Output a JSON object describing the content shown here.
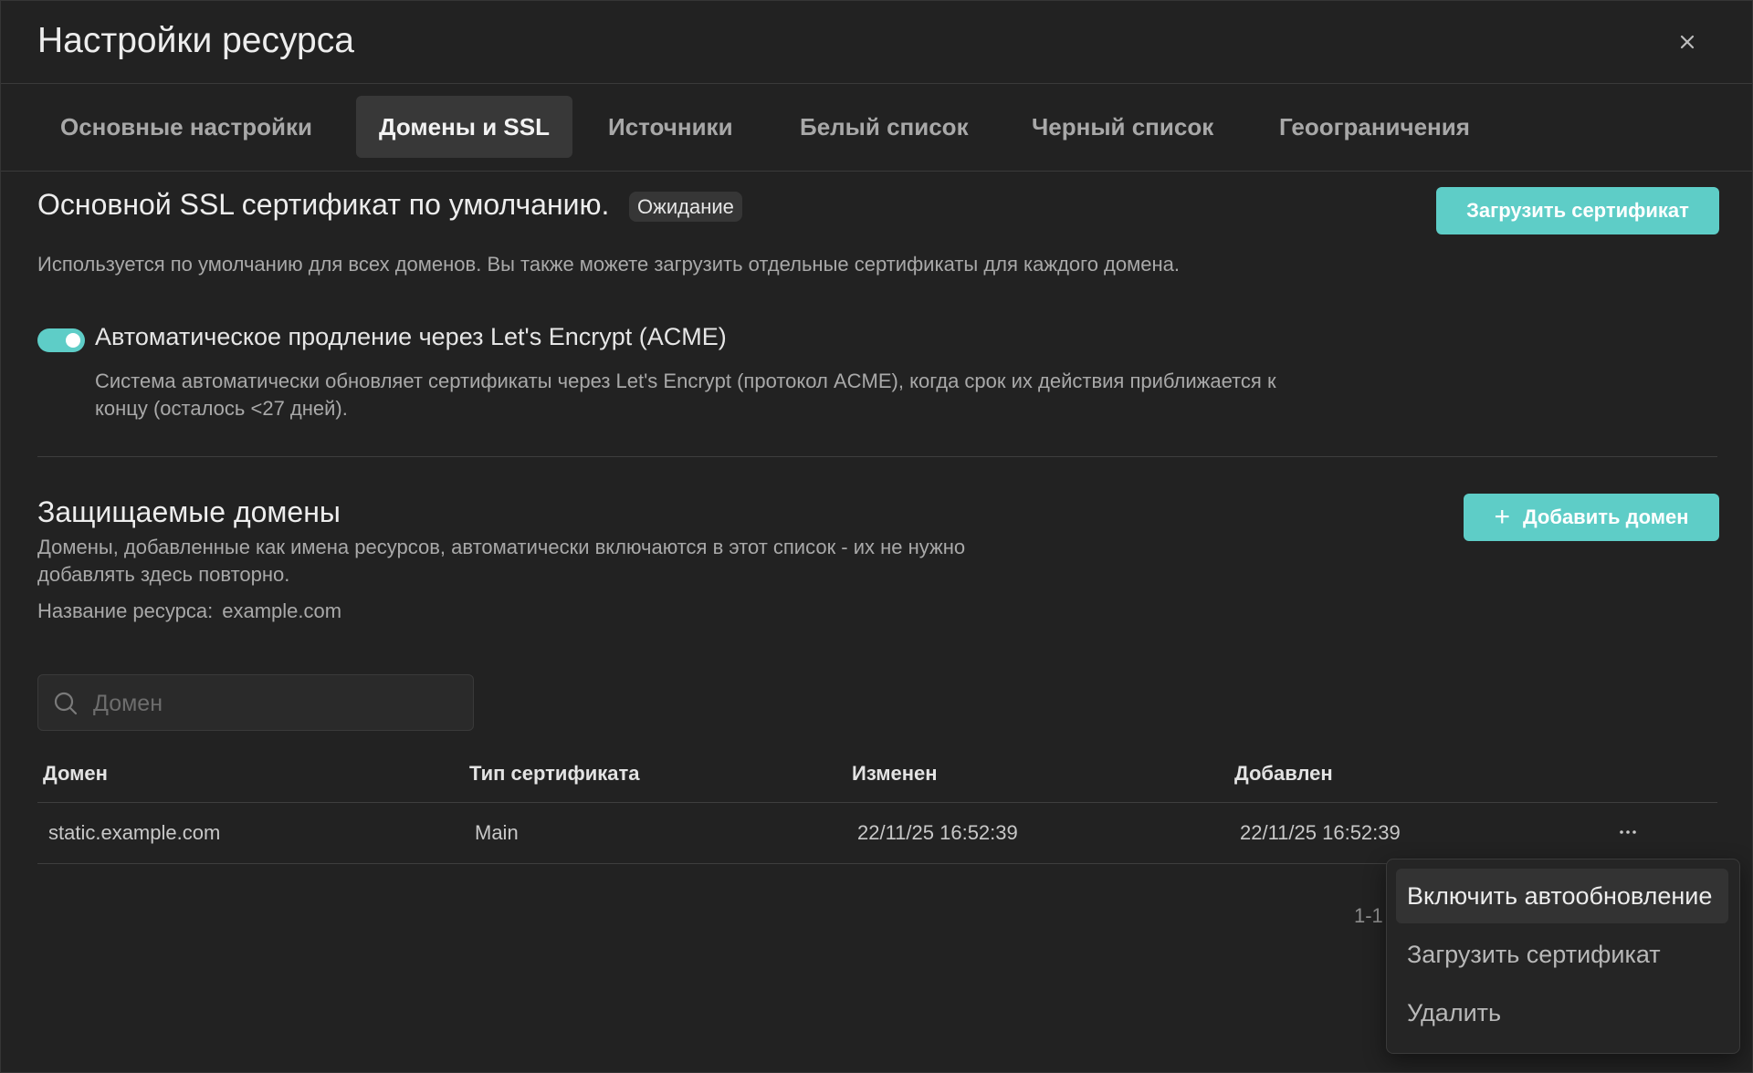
{
  "dialog": {
    "title": "Настройки ресурса"
  },
  "tabs": [
    {
      "label": "Основные настройки",
      "active": false
    },
    {
      "label": "Домены и SSL",
      "active": true
    },
    {
      "label": "Источники",
      "active": false
    },
    {
      "label": "Белый список",
      "active": false
    },
    {
      "label": "Черный список",
      "active": false
    },
    {
      "label": "Геоограничения",
      "active": false
    }
  ],
  "ssl": {
    "title": "Основной SSL сертификат по умолчанию.",
    "status_badge": "Ожидание",
    "upload_button": "Загрузить сертификат",
    "description": "Используется по умолчанию для всех доменов. Вы также можете загрузить отдельные сертификаты для каждого домена.",
    "acme_toggle_on": true,
    "acme_label": "Автоматическое продление через Let's Encrypt (ACME)",
    "acme_description_line1": "Система автоматически обновляет сертификаты через Let's Encrypt (протокол ACME), когда срок их действия приближается к",
    "acme_description_line2": "концу (осталось <27 дней)."
  },
  "domains": {
    "title": "Защищаемые домены",
    "add_button": "Добавить домен",
    "description_line1": "Домены, добавленные как имена ресурсов, автоматически включаются в этот список - их не нужно",
    "description_line2": "добавлять здесь повторно.",
    "resource_name_label": "Название ресурса:",
    "resource_name_value": "example.com",
    "search_placeholder": "Домен",
    "search_value": "",
    "columns": [
      "Домен",
      "Тип сертификата",
      "Изменен",
      "Добавлен"
    ],
    "rows": [
      {
        "domain": "static.example.com",
        "cert_type": "Main",
        "modified": "22/11/25 16:52:39",
        "added": "22/11/25 16:52:39"
      }
    ],
    "pagination": "1-1",
    "row_menu": [
      "Включить автообновление",
      "Загрузить сертификат",
      "Удалить"
    ]
  },
  "colors": {
    "accent": "#5ecdc7",
    "background": "#222222",
    "text": "#e8e8e8",
    "muted_text": "#a9a9a9"
  },
  "icons": {
    "close": "close-icon",
    "search": "search-icon",
    "add": "plus-icon",
    "row_actions": "more-horizontal-icon"
  }
}
